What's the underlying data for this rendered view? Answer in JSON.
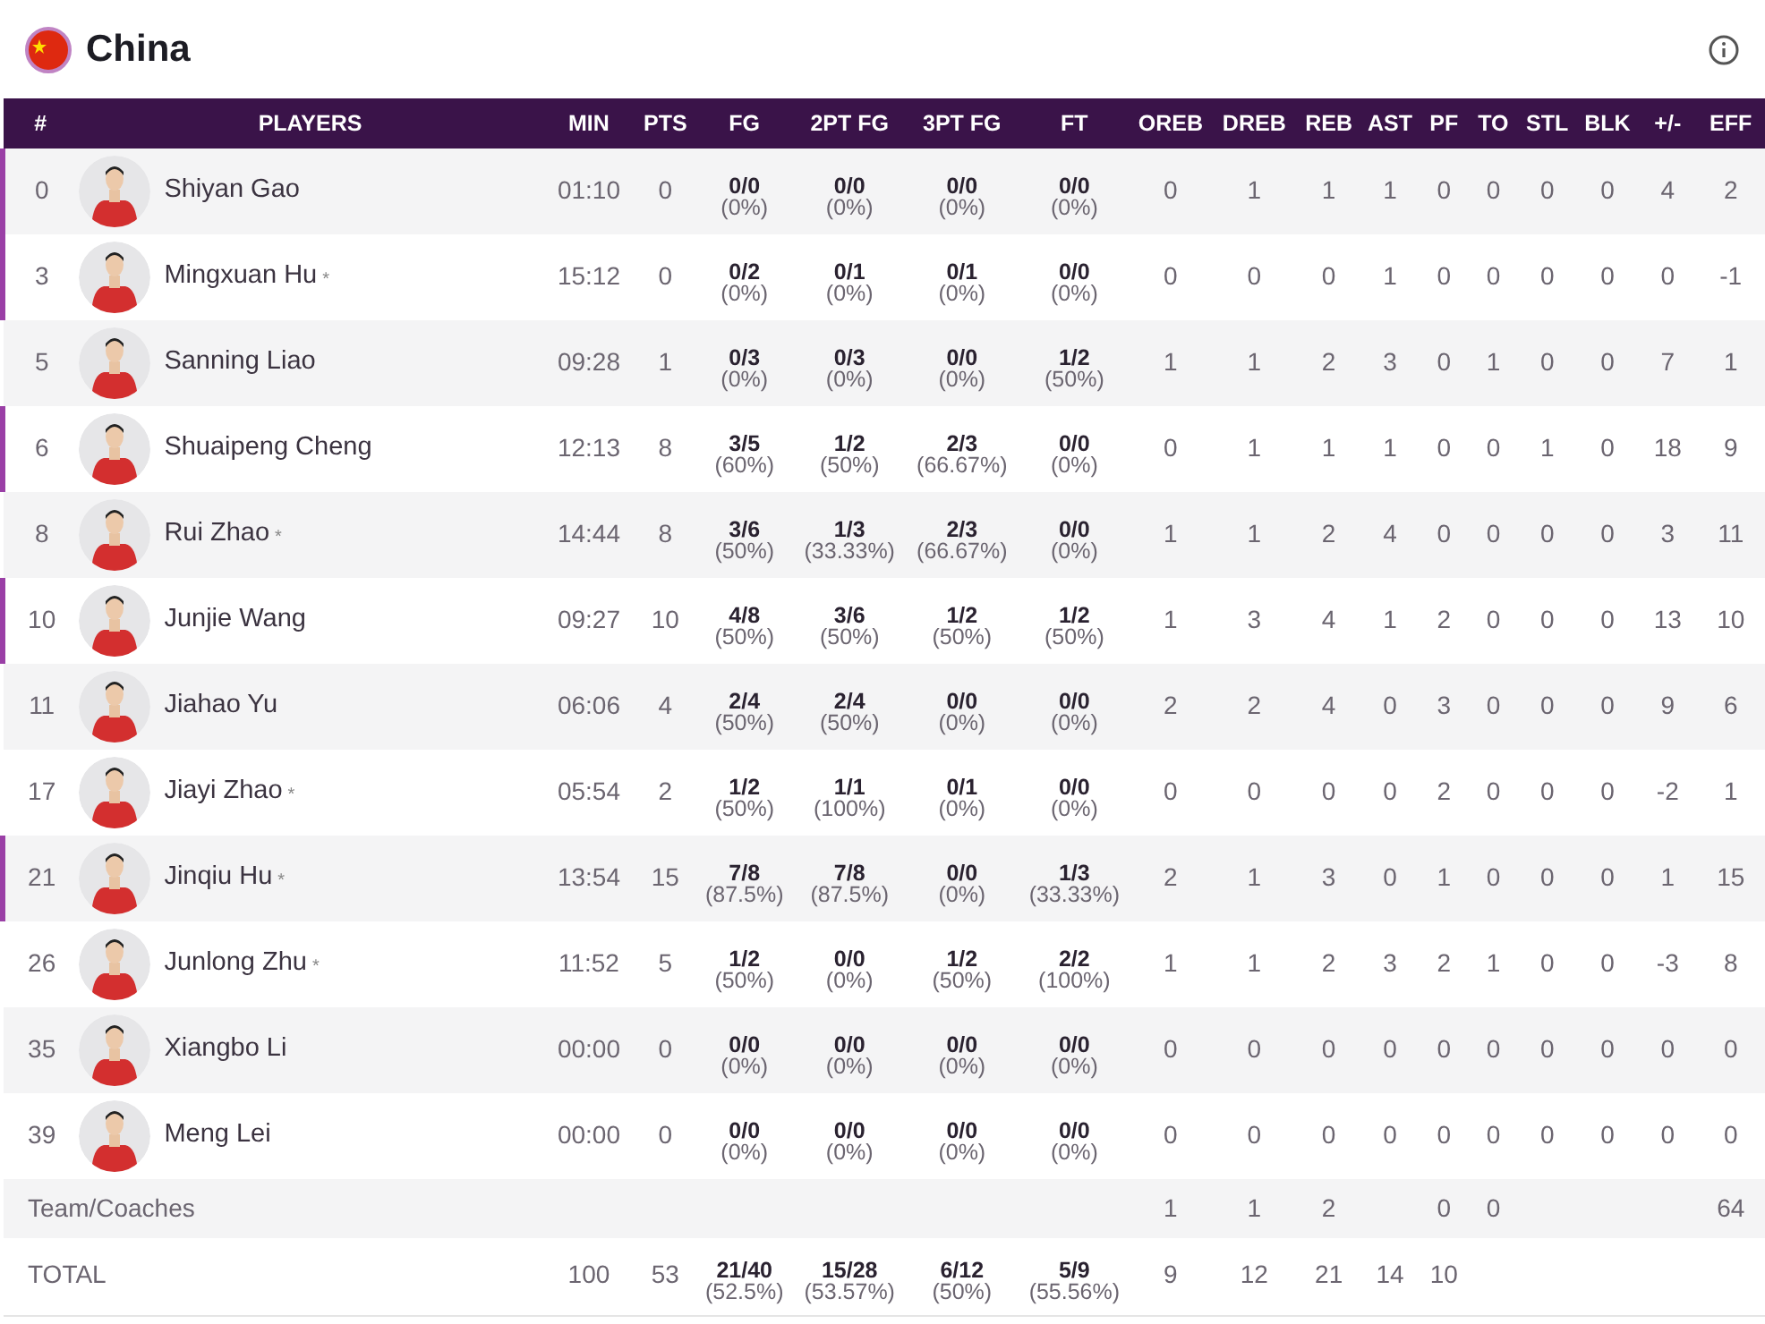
{
  "team": {
    "name": "China"
  },
  "columns": [
    "#",
    "PLAYERS",
    "MIN",
    "PTS",
    "FG",
    "2PT FG",
    "3PT FG",
    "FT",
    "OREB",
    "DREB",
    "REB",
    "AST",
    "PF",
    "TO",
    "STL",
    "BLK",
    "+/-",
    "EFF"
  ],
  "players": [
    {
      "number": "0",
      "name": "Shiyan Gao",
      "starter": true,
      "min": "01:10",
      "pts": "0",
      "shooting": [
        [
          "0/0",
          "(0%)"
        ],
        [
          "0/0",
          "(0%)"
        ],
        [
          "0/0",
          "(0%)"
        ],
        [
          "0/0",
          "(0%)"
        ]
      ],
      "stats": [
        "0",
        "1",
        "1",
        "1",
        "0",
        "0",
        "0",
        "0",
        "4",
        "2"
      ]
    },
    {
      "number": "3",
      "name": "Mingxuan Hu",
      "mark": "*",
      "starter": true,
      "min": "15:12",
      "pts": "0",
      "shooting": [
        [
          "0/2",
          "(0%)"
        ],
        [
          "0/1",
          "(0%)"
        ],
        [
          "0/1",
          "(0%)"
        ],
        [
          "0/0",
          "(0%)"
        ]
      ],
      "stats": [
        "0",
        "0",
        "0",
        "1",
        "0",
        "0",
        "0",
        "0",
        "0",
        "-1"
      ]
    },
    {
      "number": "5",
      "name": "Sanning Liao",
      "starter": false,
      "min": "09:28",
      "pts": "1",
      "shooting": [
        [
          "0/3",
          "(0%)"
        ],
        [
          "0/3",
          "(0%)"
        ],
        [
          "0/0",
          "(0%)"
        ],
        [
          "1/2",
          "(50%)"
        ]
      ],
      "stats": [
        "1",
        "1",
        "2",
        "3",
        "0",
        "1",
        "0",
        "0",
        "7",
        "1"
      ]
    },
    {
      "number": "6",
      "name": "Shuaipeng Cheng",
      "starter": true,
      "min": "12:13",
      "pts": "8",
      "shooting": [
        [
          "3/5",
          "(60%)"
        ],
        [
          "1/2",
          "(50%)"
        ],
        [
          "2/3",
          "(66.67%)"
        ],
        [
          "0/0",
          "(0%)"
        ]
      ],
      "stats": [
        "0",
        "1",
        "1",
        "1",
        "0",
        "0",
        "1",
        "0",
        "18",
        "9"
      ]
    },
    {
      "number": "8",
      "name": "Rui Zhao",
      "mark": "*",
      "starter": false,
      "min": "14:44",
      "pts": "8",
      "shooting": [
        [
          "3/6",
          "(50%)"
        ],
        [
          "1/3",
          "(33.33%)"
        ],
        [
          "2/3",
          "(66.67%)"
        ],
        [
          "0/0",
          "(0%)"
        ]
      ],
      "stats": [
        "1",
        "1",
        "2",
        "4",
        "0",
        "0",
        "0",
        "0",
        "3",
        "11"
      ]
    },
    {
      "number": "10",
      "name": "Junjie Wang",
      "starter": true,
      "min": "09:27",
      "pts": "10",
      "shooting": [
        [
          "4/8",
          "(50%)"
        ],
        [
          "3/6",
          "(50%)"
        ],
        [
          "1/2",
          "(50%)"
        ],
        [
          "1/2",
          "(50%)"
        ]
      ],
      "stats": [
        "1",
        "3",
        "4",
        "1",
        "2",
        "0",
        "0",
        "0",
        "13",
        "10"
      ]
    },
    {
      "number": "11",
      "name": "Jiahao Yu",
      "starter": false,
      "min": "06:06",
      "pts": "4",
      "shooting": [
        [
          "2/4",
          "(50%)"
        ],
        [
          "2/4",
          "(50%)"
        ],
        [
          "0/0",
          "(0%)"
        ],
        [
          "0/0",
          "(0%)"
        ]
      ],
      "stats": [
        "2",
        "2",
        "4",
        "0",
        "3",
        "0",
        "0",
        "0",
        "9",
        "6"
      ]
    },
    {
      "number": "17",
      "name": "Jiayi Zhao",
      "mark": "*",
      "starter": false,
      "min": "05:54",
      "pts": "2",
      "shooting": [
        [
          "1/2",
          "(50%)"
        ],
        [
          "1/1",
          "(100%)"
        ],
        [
          "0/1",
          "(0%)"
        ],
        [
          "0/0",
          "(0%)"
        ]
      ],
      "stats": [
        "0",
        "0",
        "0",
        "0",
        "2",
        "0",
        "0",
        "0",
        "-2",
        "1"
      ]
    },
    {
      "number": "21",
      "name": "Jinqiu Hu",
      "mark": "*",
      "starter": true,
      "min": "13:54",
      "pts": "15",
      "shooting": [
        [
          "7/8",
          "(87.5%)"
        ],
        [
          "7/8",
          "(87.5%)"
        ],
        [
          "0/0",
          "(0%)"
        ],
        [
          "1/3",
          "(33.33%)"
        ]
      ],
      "stats": [
        "2",
        "1",
        "3",
        "0",
        "1",
        "0",
        "0",
        "0",
        "1",
        "15"
      ]
    },
    {
      "number": "26",
      "name": "Junlong Zhu",
      "mark": "*",
      "starter": false,
      "min": "11:52",
      "pts": "5",
      "shooting": [
        [
          "1/2",
          "(50%)"
        ],
        [
          "0/0",
          "(0%)"
        ],
        [
          "1/2",
          "(50%)"
        ],
        [
          "2/2",
          "(100%)"
        ]
      ],
      "stats": [
        "1",
        "1",
        "2",
        "3",
        "2",
        "1",
        "0",
        "0",
        "-3",
        "8"
      ]
    },
    {
      "number": "35",
      "name": "Xiangbo Li",
      "starter": false,
      "min": "00:00",
      "pts": "0",
      "shooting": [
        [
          "0/0",
          "(0%)"
        ],
        [
          "0/0",
          "(0%)"
        ],
        [
          "0/0",
          "(0%)"
        ],
        [
          "0/0",
          "(0%)"
        ]
      ],
      "stats": [
        "0",
        "0",
        "0",
        "0",
        "0",
        "0",
        "0",
        "0",
        "0",
        "0"
      ]
    },
    {
      "number": "39",
      "name": "Meng Lei",
      "starter": false,
      "min": "00:00",
      "pts": "0",
      "shooting": [
        [
          "0/0",
          "(0%)"
        ],
        [
          "0/0",
          "(0%)"
        ],
        [
          "0/0",
          "(0%)"
        ],
        [
          "0/0",
          "(0%)"
        ]
      ],
      "stats": [
        "0",
        "0",
        "0",
        "0",
        "0",
        "0",
        "0",
        "0",
        "0",
        "0"
      ]
    }
  ],
  "team_row": {
    "label": "Team/Coaches",
    "stats": {
      "oreb": "1",
      "dreb": "1",
      "reb": "2",
      "pf": "0",
      "to": "0",
      "eff": "64"
    }
  },
  "total_row": {
    "label": "TOTAL",
    "min": "100",
    "pts": "53",
    "shooting": [
      [
        "21/40",
        "(52.5%)"
      ],
      [
        "15/28",
        "(53.57%)"
      ],
      [
        "6/12",
        "(50%)"
      ],
      [
        "5/9",
        "(55.56%)"
      ]
    ],
    "stats": [
      "9",
      "12",
      "21",
      "14",
      "10"
    ]
  }
}
